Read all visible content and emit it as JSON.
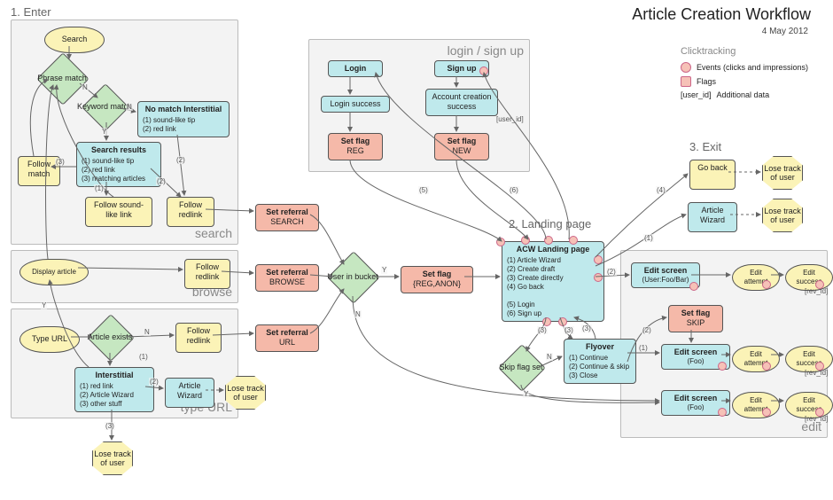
{
  "title": "Article Creation Workflow",
  "date": "4 May 2012",
  "legend": {
    "header": "Clicktracking",
    "events": "Events (clicks and impressions)",
    "flags": "Flags",
    "user_id_key": "[user_id]",
    "additional_data": "Additional data"
  },
  "sections": {
    "enter": "1. Enter",
    "landing": "2. Landing page",
    "exit": "3. Exit",
    "search_panel": "search",
    "browse_panel": "browse",
    "typeurl_panel": "type URL",
    "login_panel": "login / sign up",
    "edit_panel": "edit"
  },
  "nodes": {
    "search": "Search",
    "phrase_match": "Phrase match",
    "keyword_match": "Keyword match",
    "no_match": "No match Interstitial",
    "no_match_b1": "(1) sound-like tip",
    "no_match_b2": "(2) red link",
    "search_results": "Search results",
    "search_results_b1": "(1) sound-like tip",
    "search_results_b2": "(2) red link",
    "search_results_b3": "(3) matching articles",
    "follow_match": "Follow match",
    "follow_soundlike": "Follow sound-like link",
    "follow_redlink": "Follow redlink",
    "set_ref_search": "Set referral",
    "set_ref_search_v": "SEARCH",
    "display_article": "Display article",
    "follow_redlink2": "Follow redlink",
    "set_ref_browse": "Set referral",
    "set_ref_browse_v": "BROWSE",
    "type_url": "Type URL",
    "article_exists": "Article exists",
    "follow_redlink3": "Follow redlink",
    "interstitial": "Interstitial",
    "interstitial_b1": "(1) red link",
    "interstitial_b2": "(2) Article Wizard",
    "interstitial_b3": "(3) other stuff",
    "article_wizard_sm": "Article Wizard",
    "lose_track1": "Lose track of user",
    "lose_track2": "Lose track of user",
    "set_ref_url": "Set referral",
    "set_ref_url_v": "URL",
    "user_in_bucket": "User in bucket",
    "set_flag_reganon": "Set flag",
    "set_flag_reganon_v": "{REG,ANON}",
    "login": "Login",
    "login_success": "Login success",
    "set_flag_reg": "Set flag",
    "set_flag_reg_v": "REG",
    "signup": "Sign up",
    "acct_success": "Account creation success",
    "set_flag_new": "Set flag",
    "set_flag_new_v": "NEW",
    "acw_landing": "ACW Landing page",
    "acw_b1": "(1) Article Wizard",
    "acw_b2": "(2) Create draft",
    "acw_b3": "(3) Create directly",
    "acw_b4": "(4) Go back",
    "acw_b5": "(5) Login",
    "acw_b6": "(6) Sign up",
    "skip_flag_set": "Skip flag set",
    "flyover": "Flyover",
    "flyover_b1": "(1) Continue",
    "flyover_b2": "(2) Continue & skip",
    "flyover_b3": "(3) Close",
    "set_flag_skip": "Set flag",
    "set_flag_skip_v": "SKIP",
    "edit_screen1": "Edit screen",
    "edit_screen1_sub": "(User:Foo/Bar)",
    "edit_screen2": "Edit screen",
    "edit_screen2_sub": "(Foo)",
    "edit_screen3": "Edit screen",
    "edit_screen3_sub": "(Foo)",
    "edit_attempt": "Edit attempt",
    "edit_success": "Edit success",
    "go_back": "Go back",
    "lose_track3": "Lose track of user",
    "article_wizard_big": "Article Wizard",
    "lose_track4": "Lose track of user",
    "rev_id": "[rev_id]",
    "user_id": "[user_id]"
  },
  "edge_labels": {
    "y": "Y",
    "n": "N",
    "e1": "(1)",
    "e2": "(2)",
    "e3": "(3)",
    "e4": "(4)",
    "e5": "(5)",
    "e6": "(6)"
  }
}
